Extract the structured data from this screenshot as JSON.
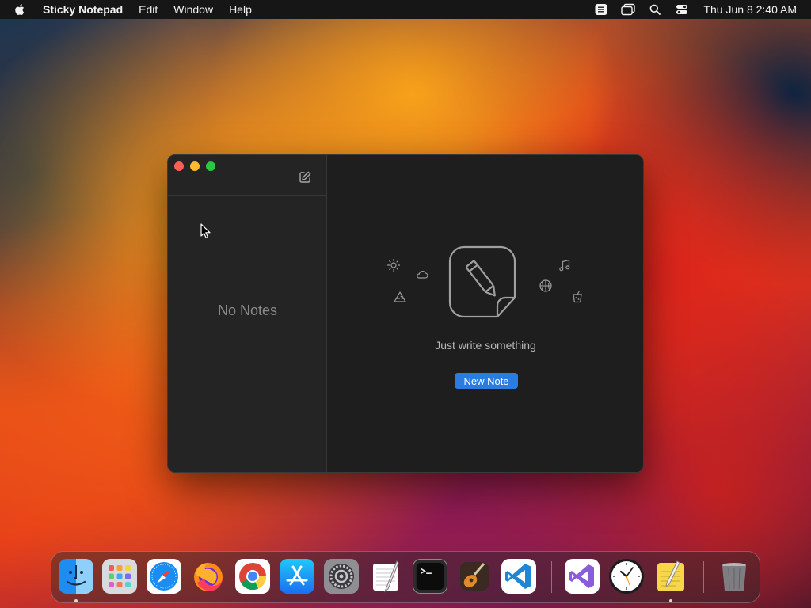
{
  "menubar": {
    "app_name": "Sticky Notepad",
    "menus": [
      "Edit",
      "Window",
      "Help"
    ],
    "clock": "Thu Jun 8  2:40 AM"
  },
  "window": {
    "sidebar": {
      "empty_text": "No Notes"
    },
    "content": {
      "tagline": "Just write something",
      "new_note_label": "New Note"
    }
  },
  "dock": {
    "apps": [
      "finder-icon",
      "launchpad-icon",
      "safari-icon",
      "firefox-icon",
      "chrome-icon",
      "app-store-icon",
      "system-settings-icon",
      "textedit-icon",
      "terminal-icon",
      "instruments-icon",
      "vscode-icon",
      "visual-studio-icon",
      "clock-icon",
      "sticky-notepad-icon",
      "trash-icon"
    ]
  },
  "colors": {
    "accent": "#2b7cdf",
    "close": "#ff5f57",
    "minimize": "#febc2e",
    "maximize": "#28c840"
  }
}
